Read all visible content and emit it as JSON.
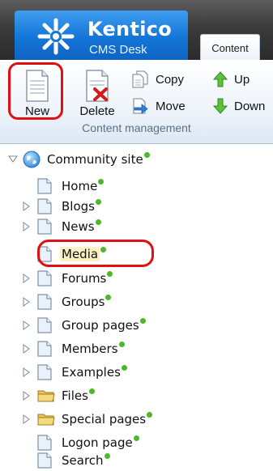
{
  "app": {
    "brand_name": "Kentico",
    "brand_sub": "CMS Desk",
    "active_tab": "Content"
  },
  "toolbar": {
    "new_label": "New",
    "delete_label": "Delete",
    "copy_label": "Copy",
    "move_label": "Move",
    "up_label": "Up",
    "down_label": "Down",
    "group_label": "Content management",
    "highlighted_button": "New"
  },
  "tree": {
    "root_label": "Community site",
    "items": [
      {
        "label": "Home",
        "icon": "page-icon",
        "expandable": false
      },
      {
        "label": "Blogs",
        "icon": "page-icon",
        "expandable": true
      },
      {
        "label": "News",
        "icon": "page-icon",
        "expandable": true
      },
      {
        "label": "Media",
        "icon": "page-icon",
        "expandable": false,
        "highlighted": true
      },
      {
        "label": "Forums",
        "icon": "page-icon",
        "expandable": true
      },
      {
        "label": "Groups",
        "icon": "page-icon",
        "expandable": true
      },
      {
        "label": "Group pages",
        "icon": "page-icon",
        "expandable": true
      },
      {
        "label": "Members",
        "icon": "page-icon",
        "expandable": true
      },
      {
        "label": "Examples",
        "icon": "page-icon",
        "expandable": true
      },
      {
        "label": "Files",
        "icon": "folder-icon",
        "expandable": true
      },
      {
        "label": "Special pages",
        "icon": "folder-icon",
        "expandable": true
      },
      {
        "label": "Logon page",
        "icon": "page-icon",
        "expandable": false
      },
      {
        "label": "Search",
        "icon": "page-icon",
        "expandable": false
      }
    ]
  },
  "colors": {
    "status_published": "#4cb82a",
    "highlight_ring": "#e01010",
    "brand_blue": "#1475d8"
  }
}
